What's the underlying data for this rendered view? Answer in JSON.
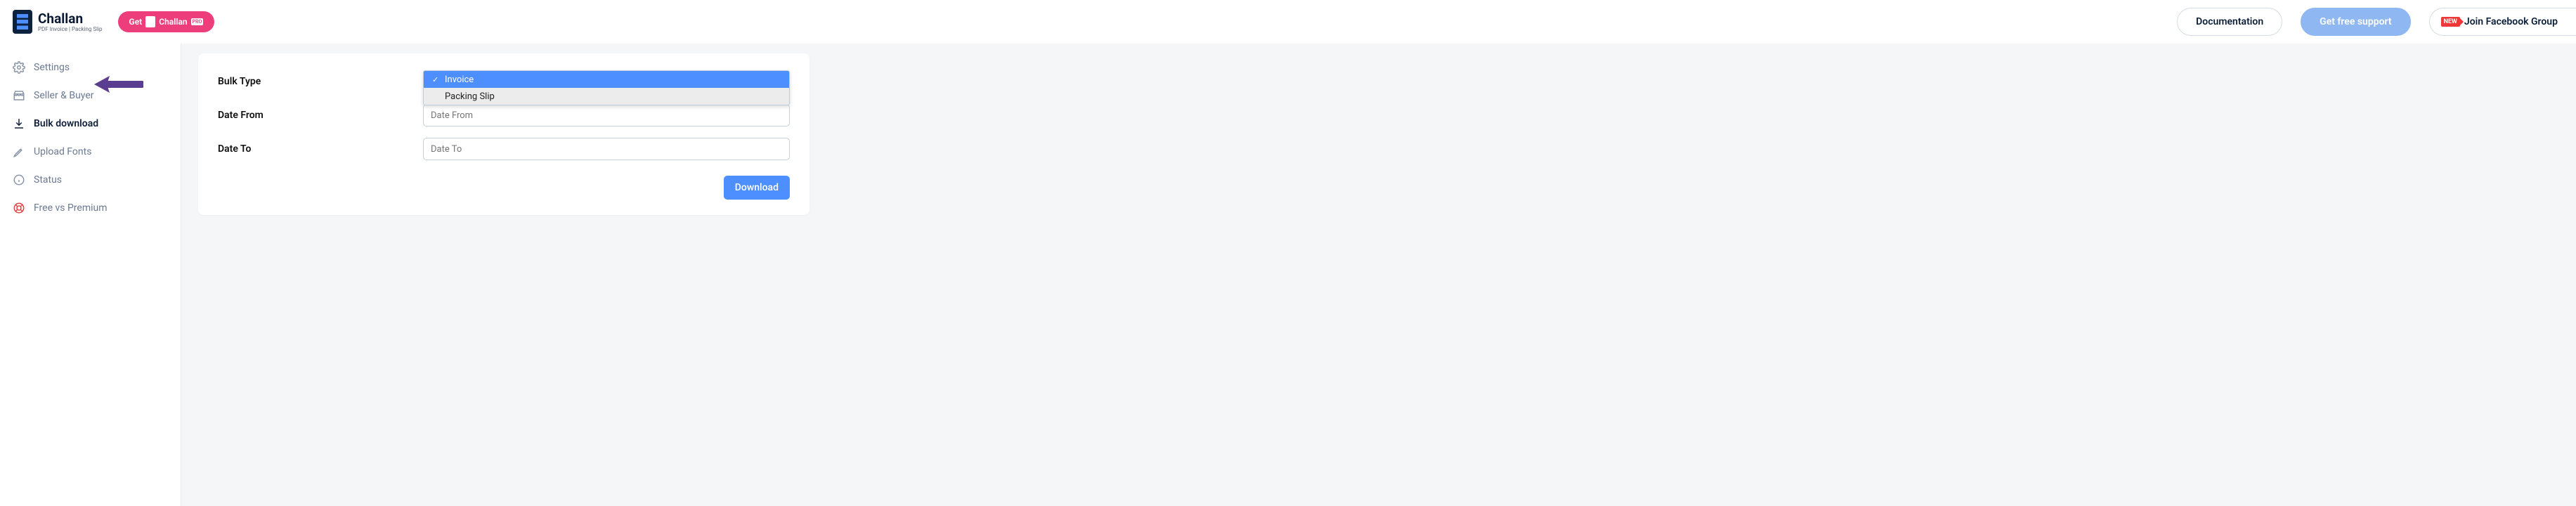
{
  "header": {
    "logo_main": "Challan",
    "logo_sub": "PDF Invoice | Packing Slip",
    "pro_prefix": "Get",
    "pro_word": "Challan",
    "pro_badge": "PRO",
    "buttons": {
      "doc": "Documentation",
      "support": "Get free support",
      "fb": "Join Facebook Group",
      "new": "NEW"
    }
  },
  "sidebar": {
    "items": [
      {
        "label": "Settings"
      },
      {
        "label": "Seller & Buyer"
      },
      {
        "label": "Bulk download"
      },
      {
        "label": "Upload Fonts"
      },
      {
        "label": "Status"
      },
      {
        "label": "Free vs Premium"
      }
    ]
  },
  "form": {
    "bulk_type_label": "Bulk Type",
    "bulk_type_options": [
      "Invoice",
      "Packing Slip"
    ],
    "bulk_type_selected": "Invoice",
    "date_from_label": "Date From",
    "date_from_placeholder": "Date From",
    "date_to_label": "Date To",
    "date_to_placeholder": "Date To",
    "download": "Download"
  }
}
